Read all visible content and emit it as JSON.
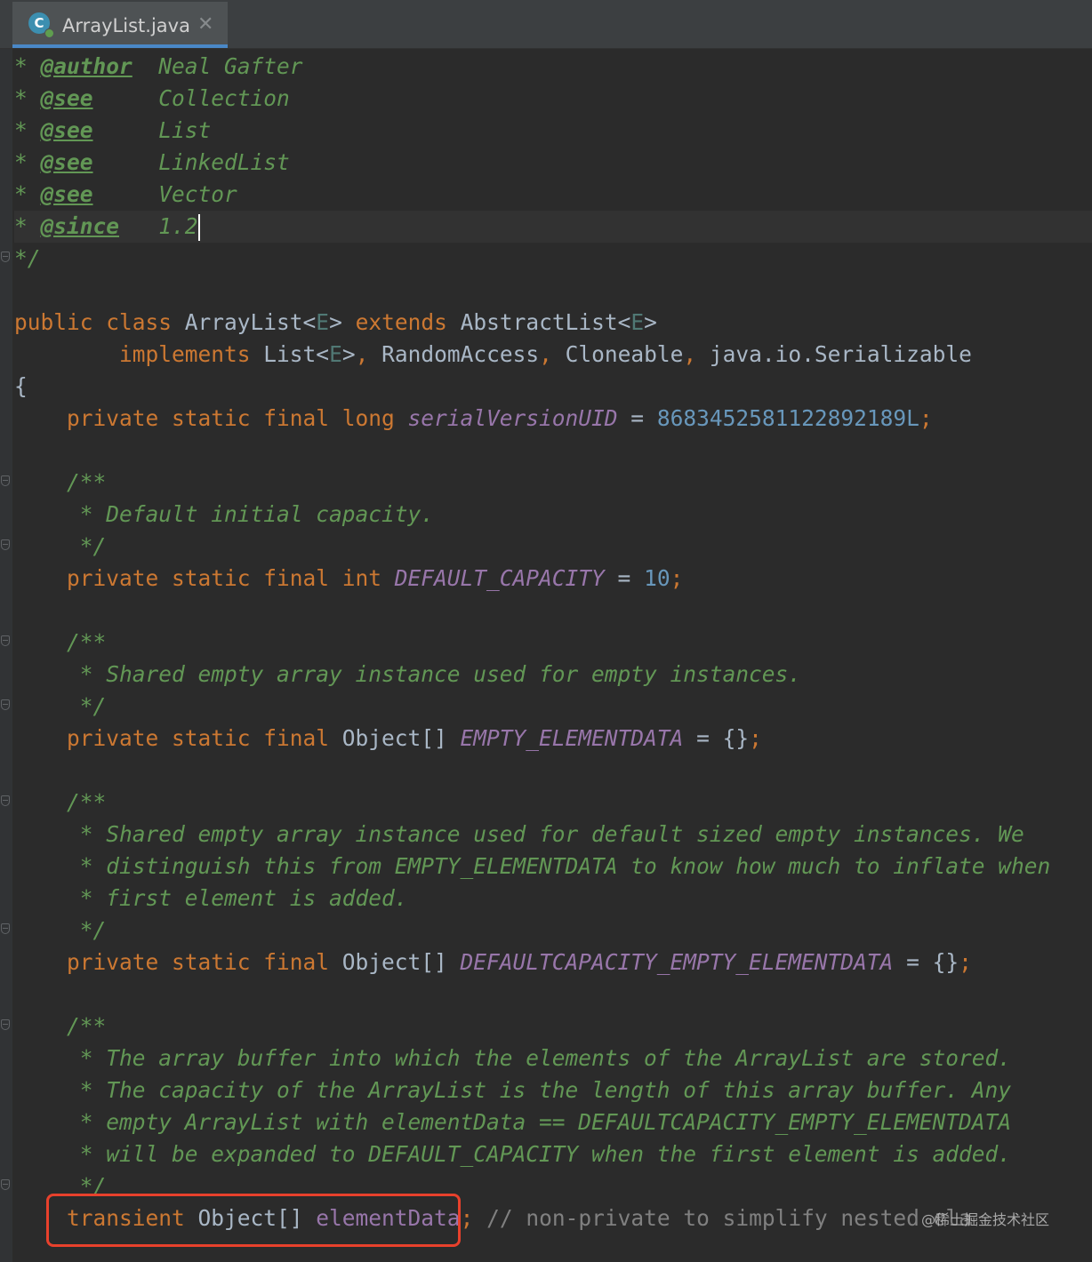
{
  "tab": {
    "icon_letter": "C",
    "title": "ArrayList.java",
    "close_glyph": "✕"
  },
  "code": {
    "l1": {
      "star": "* ",
      "tag": "@author",
      "pad": "  ",
      "text": "Neal Gafter"
    },
    "l2": {
      "star": "* ",
      "tag": "@see",
      "pad": "     ",
      "text": "Collection"
    },
    "l3": {
      "star": "* ",
      "tag": "@see",
      "pad": "     ",
      "text": "List"
    },
    "l4": {
      "star": "* ",
      "tag": "@see",
      "pad": "     ",
      "text": "LinkedList"
    },
    "l5": {
      "star": "* ",
      "tag": "@see",
      "pad": "     ",
      "text": "Vector"
    },
    "l6": {
      "star": "* ",
      "tag": "@since",
      "pad": "   ",
      "text": "1.2"
    },
    "l7": {
      "doc": "*/"
    },
    "l9": {
      "kw1": "public class ",
      "name": "ArrayList",
      "lt1": "<",
      "e1": "E",
      "gt1": "> ",
      "kw2": "extends ",
      "parent": "AbstractList",
      "lt2": "<",
      "e2": "E",
      "gt2": ">"
    },
    "l10": {
      "indent": "        ",
      "kw": "implements ",
      "t1": "List",
      "lt": "<",
      "e": "E",
      "gt": ">",
      "c1": ", ",
      "t2": "RandomAccess",
      "c2": ", ",
      "t3": "Cloneable",
      "c3": ", ",
      "t4": "java.io.Serializable"
    },
    "l11": {
      "brace": "{"
    },
    "l12": {
      "indent": "    ",
      "kw": "private static final long ",
      "field": "serialVersionUID",
      "eq": " = ",
      "num": "8683452581122892189L",
      "semi": ";"
    },
    "l14": {
      "doc": "    /**"
    },
    "l15": {
      "doc": "     * Default initial capacity."
    },
    "l16": {
      "doc": "     */"
    },
    "l17": {
      "indent": "    ",
      "kw": "private static final int ",
      "field": "DEFAULT_CAPACITY",
      "eq": " = ",
      "num": "10",
      "semi": ";"
    },
    "l19": {
      "doc": "    /**"
    },
    "l20": {
      "doc": "     * Shared empty array instance used for empty instances."
    },
    "l21": {
      "doc": "     */"
    },
    "l22": {
      "indent": "    ",
      "kw": "private static final ",
      "type": "Object[] ",
      "field": "EMPTY_ELEMENTDATA",
      "rest": " = {}",
      "semi": ";"
    },
    "l24": {
      "doc": "    /**"
    },
    "l25": {
      "doc": "     * Shared empty array instance used for default sized empty instances. We"
    },
    "l26": {
      "doc": "     * distinguish this from EMPTY_ELEMENTDATA to know how much to inflate when"
    },
    "l27": {
      "doc": "     * first element is added."
    },
    "l28": {
      "doc": "     */"
    },
    "l29": {
      "indent": "    ",
      "kw": "private static final ",
      "type": "Object[] ",
      "field": "DEFAULTCAPACITY_EMPTY_ELEMENTDATA",
      "rest": " = {}",
      "semi": ";"
    },
    "l31": {
      "doc": "    /**"
    },
    "l32": {
      "doc": "     * The array buffer into which the elements of the ArrayList are stored."
    },
    "l33": {
      "doc": "     * The capacity of the ArrayList is the length of this array buffer. Any"
    },
    "l34": {
      "doc": "     * empty ArrayList with elementData == DEFAULTCAPACITY_EMPTY_ELEMENTDATA"
    },
    "l35": {
      "doc": "     * will be expanded to DEFAULT_CAPACITY when the first element is added."
    },
    "l36": {
      "doc": "     */"
    },
    "l37": {
      "indent": "    ",
      "kw": "transient ",
      "type": "Object[] ",
      "field": "elementData",
      "semi": ";",
      "comment": " // non-private to simplify nested cla"
    }
  },
  "watermark": "@稀土掘金技术社区",
  "colors": {
    "background": "#2b2b2b",
    "keyword": "#cc7832",
    "doc_comment": "#629755",
    "field": "#9876aa",
    "number": "#6897bb",
    "highlight_border": "#e8412c",
    "tab_underline": "#4a88c7"
  }
}
